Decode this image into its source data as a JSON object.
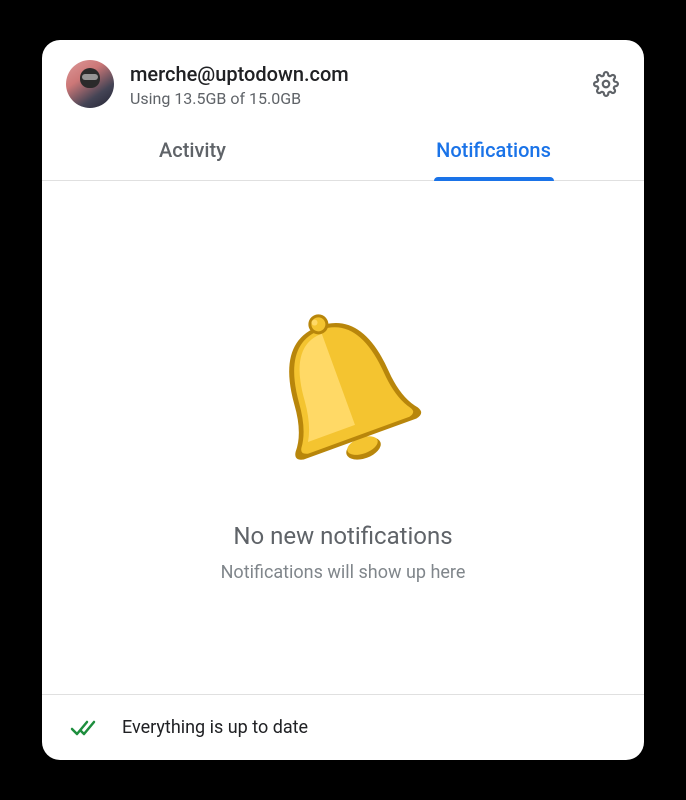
{
  "header": {
    "email": "merche@uptodown.com",
    "storage": "Using 13.5GB of 15.0GB"
  },
  "tabs": {
    "activity": "Activity",
    "notifications": "Notifications"
  },
  "content": {
    "title": "No new notifications",
    "subtitle": "Notifications will show up here"
  },
  "footer": {
    "status": "Everything is up to date"
  }
}
